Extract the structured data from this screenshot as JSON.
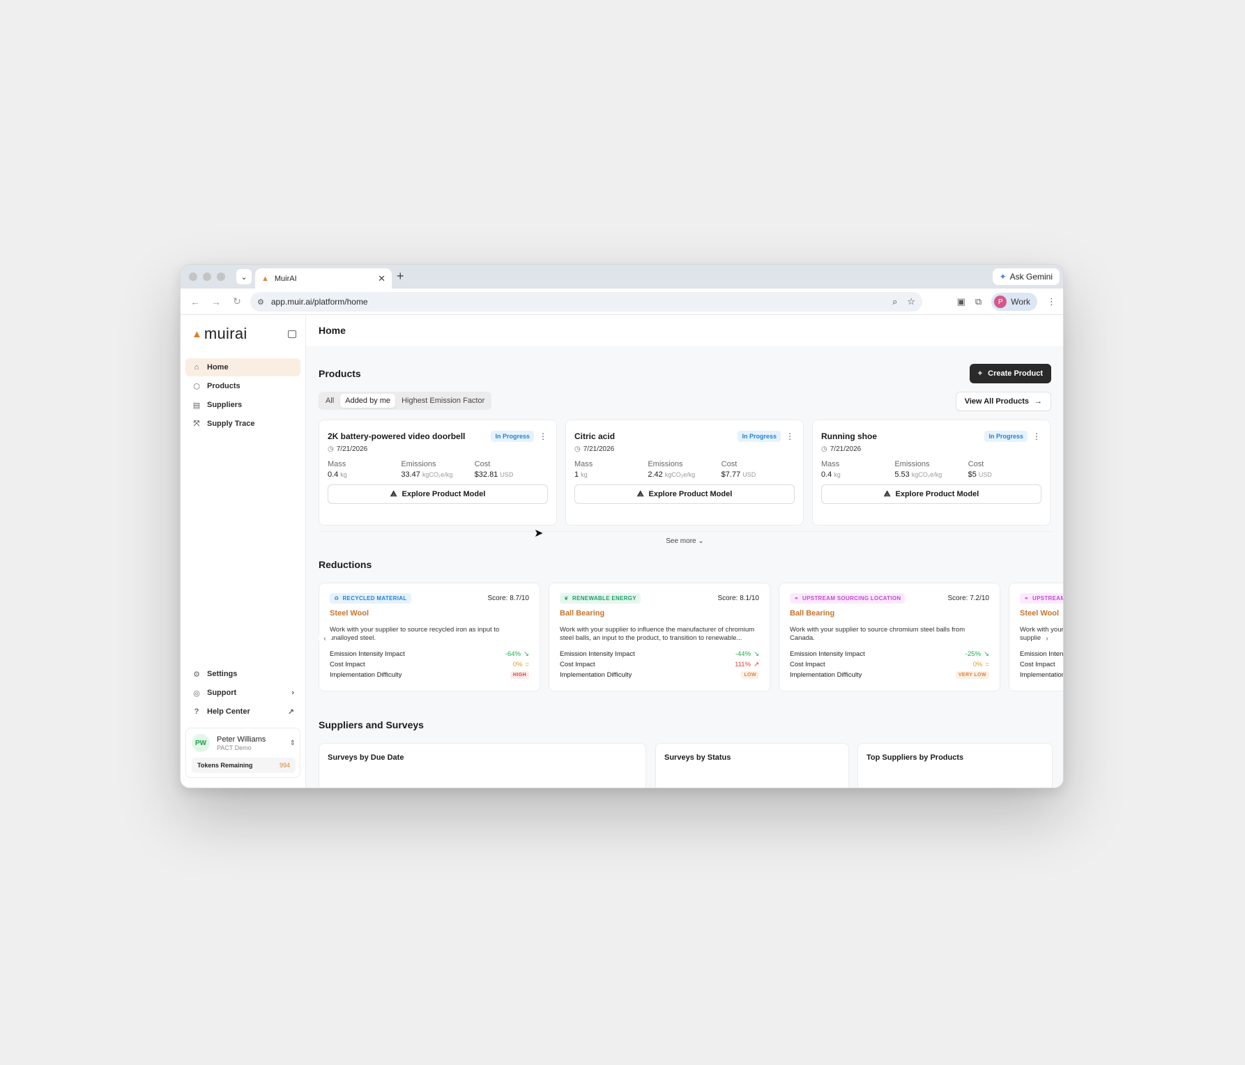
{
  "browser": {
    "tab_title": "MuirAI",
    "tab_close": "✕",
    "new_tab": "+",
    "ask_gemini": "Ask Gemini",
    "url": "app.muir.ai/platform/home",
    "profile_initial": "P",
    "profile_label": "Work"
  },
  "sidebar": {
    "brand": "muirai",
    "nav": [
      {
        "label": "Home"
      },
      {
        "label": "Products"
      },
      {
        "label": "Suppliers"
      },
      {
        "label": "Supply Trace"
      }
    ],
    "bottom": [
      {
        "label": "Settings"
      },
      {
        "label": "Support"
      },
      {
        "label": "Help Center"
      }
    ],
    "user": {
      "initials": "PW",
      "name": "Peter Williams",
      "org": "PACT Demo",
      "tokens_label": "Tokens Remaining",
      "tokens_value": "994"
    }
  },
  "page": {
    "title": "Home"
  },
  "products": {
    "title": "Products",
    "create_label": "Create Product",
    "view_all_label": "View All Products",
    "filters": [
      "All",
      "Added by me",
      "Highest Emission Factor"
    ],
    "see_more": "See more",
    "metric_labels": {
      "mass": "Mass",
      "emissions": "Emissions",
      "cost": "Cost"
    },
    "explore_label": "Explore Product Model",
    "status_color": "#1f84d6",
    "items": [
      {
        "name": "2K battery-powered video doorbell",
        "status": "In Progress",
        "date": "7/21/2026",
        "mass": "0.4",
        "mass_unit": "kg",
        "emissions": "33.47",
        "emissions_unit": "kgCO₂e/kg",
        "cost": "$32.81",
        "cost_unit": "USD"
      },
      {
        "name": "Citric acid",
        "status": "In Progress",
        "date": "7/21/2026",
        "mass": "1",
        "mass_unit": "kg",
        "emissions": "2.42",
        "emissions_unit": "kgCO₂e/kg",
        "cost": "$7.77",
        "cost_unit": "USD"
      },
      {
        "name": "Running shoe",
        "status": "In Progress",
        "date": "7/21/2026",
        "mass": "0.4",
        "mass_unit": "kg",
        "emissions": "5.53",
        "emissions_unit": "kgCO₂e/kg",
        "cost": "$5",
        "cost_unit": "USD"
      }
    ]
  },
  "reductions": {
    "title": "Reductions",
    "row_labels": {
      "emission": "Emission Intensity Impact",
      "cost": "Cost Impact",
      "difficulty": "Implementation Difficulty"
    },
    "items": [
      {
        "tag": "RECYCLED MATERIAL",
        "score": "Score: 8.7/10",
        "name": "Steel Wool",
        "desc": "Work with your supplier to source recycled iron as input to unalloyed steel.",
        "emission": "-64%",
        "cost": "0%",
        "difficulty": "HIGH"
      },
      {
        "tag": "RENEWABLE ENERGY",
        "score": "Score: 8.1/10",
        "name": "Ball Bearing",
        "desc": "Work with your supplier to influence the manufacturer of chromium steel balls, an input to the product, to transition to renewable...",
        "emission": "-44%",
        "cost": "111%",
        "difficulty": "LOW"
      },
      {
        "tag": "UPSTREAM SOURCING LOCATION",
        "score": "Score: 7.2/10",
        "name": "Ball Bearing",
        "desc": "Work with your supplier to source chromium steel balls from Canada.",
        "emission": "-25%",
        "cost": "0%",
        "difficulty": "VERY LOW"
      },
      {
        "tag": "UPSTREAM SOURCING LOCATION",
        "score": "",
        "name": "Steel Wool",
        "desc": "Work with your supplier",
        "emission": "",
        "cost": "",
        "difficulty": ""
      }
    ]
  },
  "suppliers": {
    "title": "Suppliers and Surveys",
    "cards": [
      "Surveys by Due Date",
      "Surveys by Status",
      "Top Suppliers by Products"
    ]
  },
  "colors": {
    "accent": "#d9822b",
    "positive": "#1faa4f",
    "negative": "#e0403a",
    "neutral": "#e09a1f",
    "recycled_tag": "#1f84d6",
    "renewable_tag": "#1f9d6a",
    "upstream_tag": "#c24bd1"
  }
}
